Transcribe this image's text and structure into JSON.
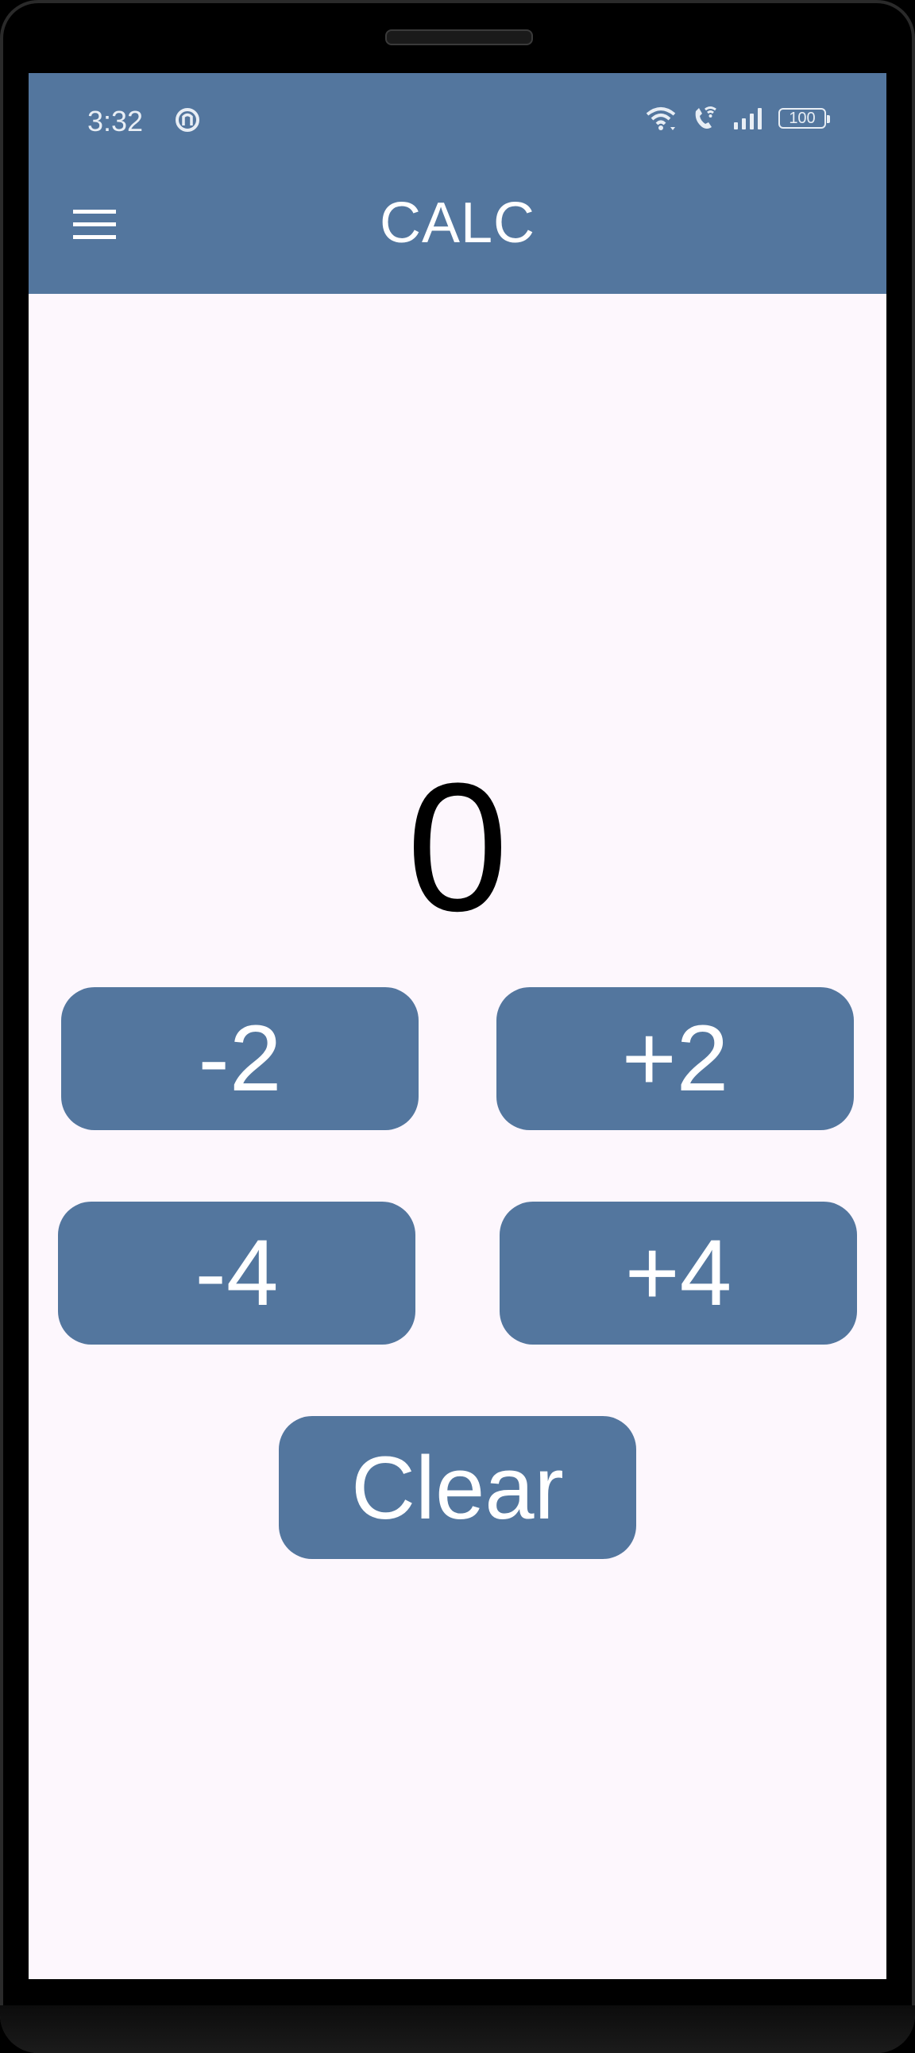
{
  "status_bar": {
    "time": "3:32",
    "battery": "100",
    "icons": [
      "app-notification-icon",
      "wifi-icon",
      "wifi-call-icon",
      "cell-signal-icon",
      "battery-icon"
    ]
  },
  "app_bar": {
    "title": "CALC",
    "menu_icon": "hamburger-menu-icon"
  },
  "display": {
    "value": "0"
  },
  "buttons": {
    "minus_two": "-2",
    "plus_two": "+2",
    "minus_four": "-4",
    "plus_four": "+4",
    "clear": "Clear"
  },
  "colors": {
    "primary": "#53769e",
    "background": "#fdf7fd",
    "on_primary": "#ffffff",
    "display_text": "#000000"
  }
}
